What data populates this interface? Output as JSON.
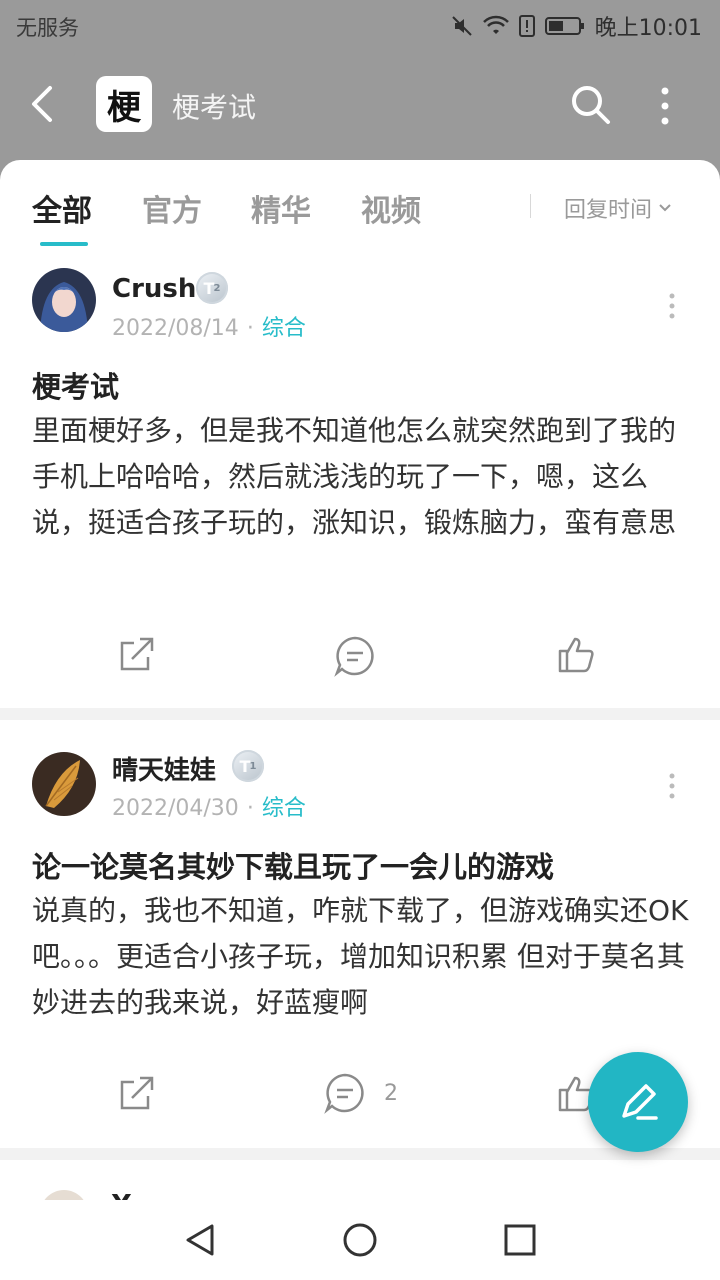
{
  "status_bar": {
    "carrier": "无服务",
    "time": "晚上10:01"
  },
  "header": {
    "logo_char": "梗",
    "title": "梗考试"
  },
  "tabs": [
    {
      "label": "全部",
      "active": true
    },
    {
      "label": "官方",
      "active": false
    },
    {
      "label": "精华",
      "active": false
    },
    {
      "label": "视频",
      "active": false
    }
  ],
  "sort": {
    "label": "回复时间"
  },
  "posts": [
    {
      "username": "Crush",
      "level": "T",
      "level_num": "2",
      "date": "2022/08/14",
      "category": "综合",
      "title": "梗考试",
      "body": "里面梗好多，但是我不知道他怎么就突然跑到了我的手机上哈哈哈，然后就浅浅的玩了一下，嗯，这么说，挺适合孩子玩的，涨知识，锻炼脑力，蛮有意思",
      "comment_count": "",
      "icons": [
        "share-icon",
        "comment-icon",
        "like-icon"
      ]
    },
    {
      "username": "晴天娃娃",
      "level": "T",
      "level_num": "1",
      "date": "2022/04/30",
      "category": "综合",
      "title": "论一论莫名其妙下载且玩了一会儿的游戏",
      "body": "说真的，我也不知道，咋就下载了，但游戏确实还OK吧。。。更适合小孩子玩，增加知识积累 但对于莫名其妙进去的我来说，好蓝瘦啊",
      "comment_count": "2",
      "icons": [
        "share-icon",
        "comment-icon",
        "like-icon"
      ]
    }
  ],
  "partial_post": {
    "username": "Y…"
  },
  "colors": {
    "accent": "#27bcc9",
    "dim_header": "#9a9a9a",
    "fab": "#22b6c4"
  }
}
